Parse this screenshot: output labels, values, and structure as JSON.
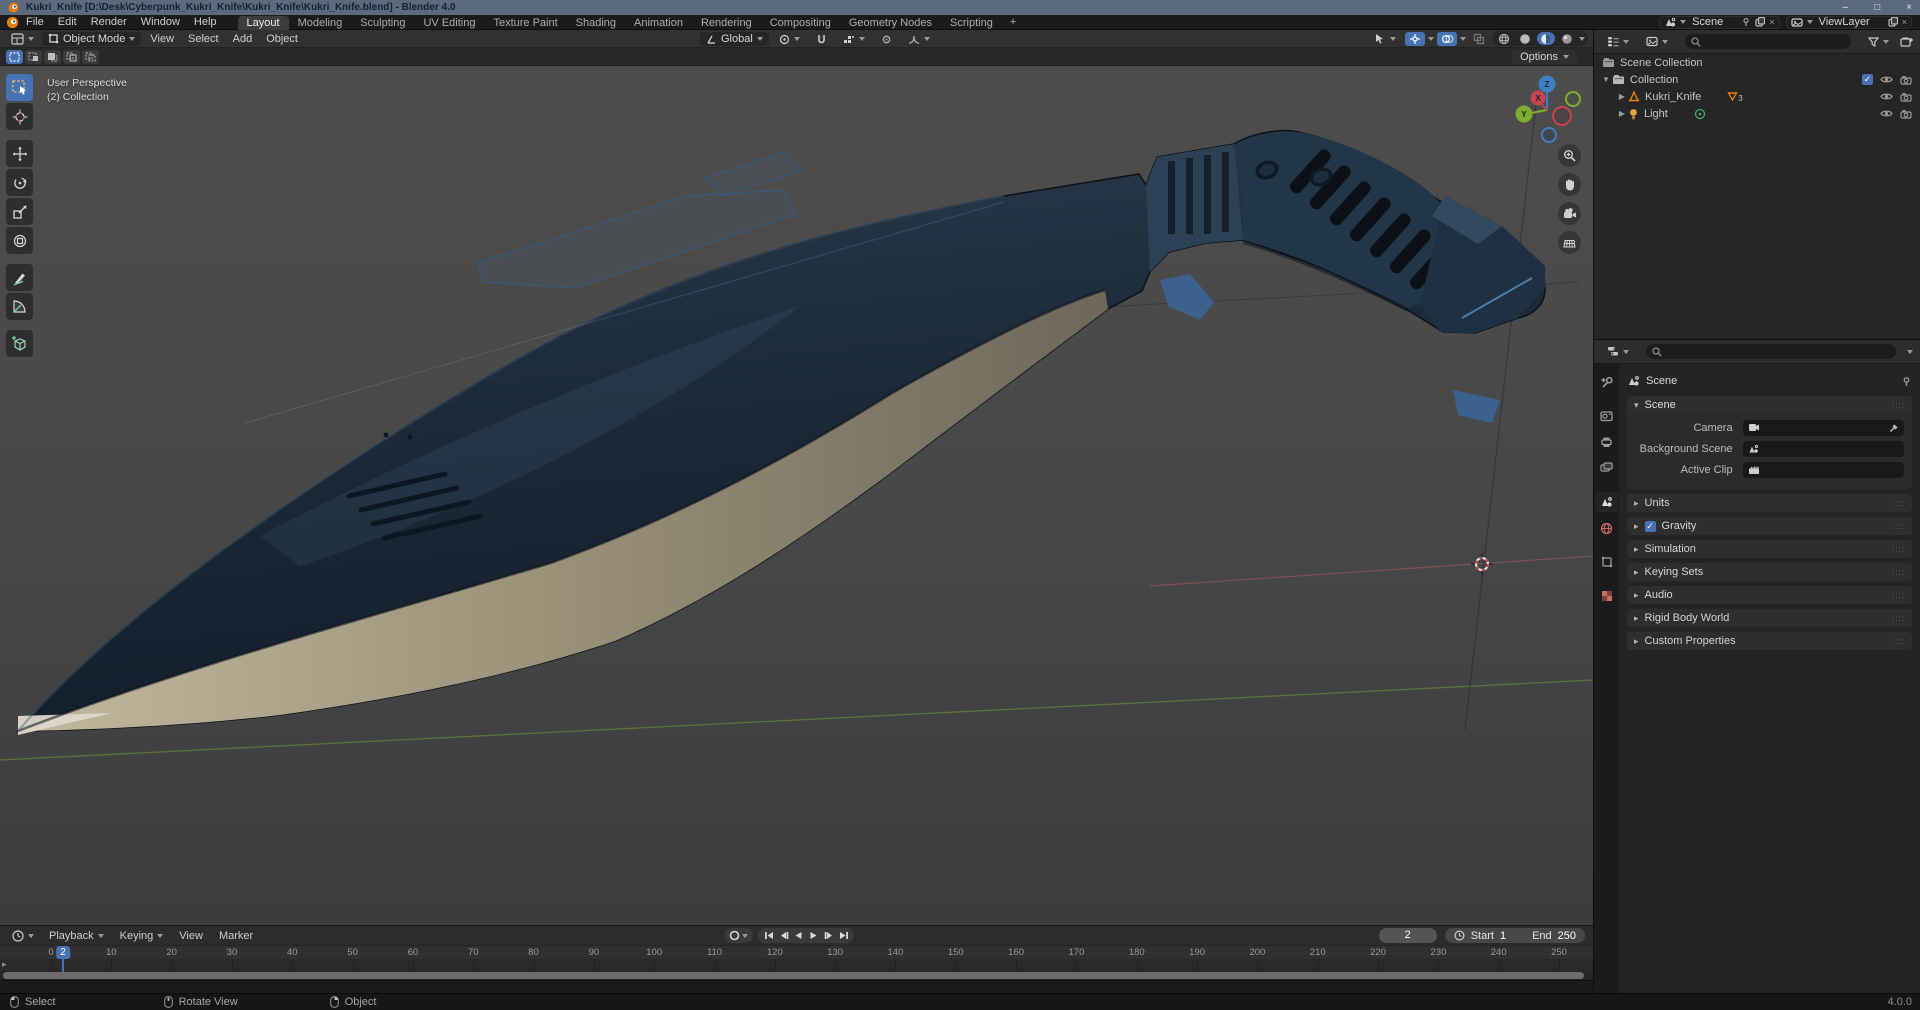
{
  "window": {
    "title": "Kukri_Knife [D:\\Desk\\Cyberpunk_Kukri_Knife\\Kukri_Knife\\Kukri_Knife.blend] - Blender 4.0"
  },
  "topbar": {
    "menus": [
      "File",
      "Edit",
      "Render",
      "Window",
      "Help"
    ],
    "workspaces": [
      "Layout",
      "Modeling",
      "Sculpting",
      "UV Editing",
      "Texture Paint",
      "Shading",
      "Animation",
      "Rendering",
      "Compositing",
      "Geometry Nodes",
      "Scripting"
    ],
    "active_workspace": "Layout",
    "add_workspace": "+",
    "scene_label": "Scene",
    "viewlayer_label": "ViewLayer"
  },
  "viewport": {
    "header": {
      "mode": "Object Mode",
      "menus": [
        "View",
        "Select",
        "Add",
        "Object"
      ],
      "orientation": "Global",
      "options_label": "Options"
    },
    "overlay": {
      "line1": "User Perspective",
      "line2": "(2) Collection"
    },
    "gizmo": {
      "x": "X",
      "y": "Y",
      "z": "Z"
    }
  },
  "outliner": {
    "rows": [
      {
        "label": "Scene Collection"
      },
      {
        "label": "Collection"
      },
      {
        "label": "Kukri_Knife",
        "badge": "3"
      },
      {
        "label": "Light"
      }
    ]
  },
  "properties": {
    "breadcrumb": "Scene",
    "scene_panel": {
      "title": "Scene",
      "fields": [
        {
          "label": "Camera"
        },
        {
          "label": "Background Scene"
        },
        {
          "label": "Active Clip"
        }
      ]
    },
    "collapsed": [
      "Units",
      "Gravity",
      "Simulation",
      "Keying Sets",
      "Audio",
      "Rigid Body World",
      "Custom Properties"
    ]
  },
  "timeline": {
    "menus": [
      "Playback",
      "Keying",
      "View",
      "Marker"
    ],
    "current_frame": "2",
    "start_label": "Start",
    "start": "1",
    "end_label": "End",
    "end": "250",
    "ticks": [
      0,
      10,
      20,
      30,
      40,
      50,
      60,
      70,
      80,
      90,
      100,
      110,
      120,
      130,
      140,
      150,
      160,
      170,
      180,
      190,
      200,
      210,
      220,
      230,
      240,
      250
    ]
  },
  "statusbar": {
    "items": [
      {
        "label": "Select"
      },
      {
        "label": "Rotate View"
      },
      {
        "label": "Object"
      }
    ],
    "version": "4.0.0"
  },
  "colors": {
    "accent": "#4772b3",
    "axis_x": "#c6434f",
    "axis_y": "#7fae2e",
    "axis_z": "#3d7fc4",
    "blender_orange": "#e87d0d"
  }
}
